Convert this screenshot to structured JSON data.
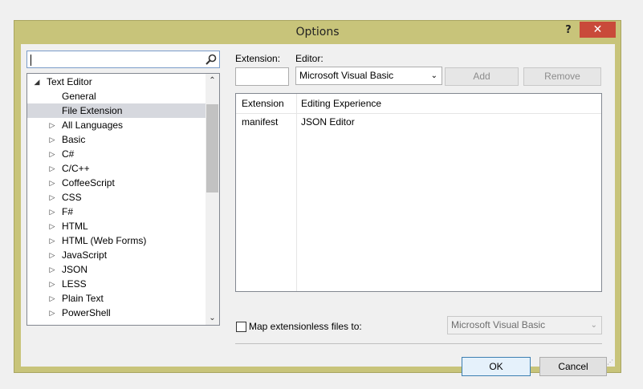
{
  "window": {
    "title": "Options",
    "help": "?",
    "close": "✕"
  },
  "search": {
    "value": ""
  },
  "tree": {
    "items": [
      {
        "label": "Text Editor",
        "toggle": "◢"
      },
      {
        "label": "General",
        "toggle": ""
      },
      {
        "label": "File Extension",
        "toggle": ""
      },
      {
        "label": "All Languages",
        "toggle": "▷"
      },
      {
        "label": "Basic",
        "toggle": "▷"
      },
      {
        "label": "C#",
        "toggle": "▷"
      },
      {
        "label": "C/C++",
        "toggle": "▷"
      },
      {
        "label": "CoffeeScript",
        "toggle": "▷"
      },
      {
        "label": "CSS",
        "toggle": "▷"
      },
      {
        "label": "F#",
        "toggle": "▷"
      },
      {
        "label": "HTML",
        "toggle": "▷"
      },
      {
        "label": "HTML (Web Forms)",
        "toggle": "▷"
      },
      {
        "label": "JavaScript",
        "toggle": "▷"
      },
      {
        "label": "JSON",
        "toggle": "▷"
      },
      {
        "label": "LESS",
        "toggle": "▷"
      },
      {
        "label": "Plain Text",
        "toggle": "▷"
      },
      {
        "label": "PowerShell",
        "toggle": "▷"
      }
    ],
    "selected": "File Extension"
  },
  "extension": {
    "label": "Extension:",
    "value": ""
  },
  "editor": {
    "label": "Editor:",
    "selected": "Microsoft Visual Basic"
  },
  "buttons": {
    "add": "Add",
    "remove": "Remove",
    "ok": "OK",
    "cancel": "Cancel"
  },
  "mappings": {
    "columns": [
      "Extension",
      "Editing Experience"
    ],
    "rows": [
      {
        "extension": "manifest",
        "editor": "JSON Editor"
      }
    ]
  },
  "map_extensionless": {
    "label": "Map extensionless files to:",
    "checked": false,
    "selected": "Microsoft Visual Basic"
  },
  "colors": {
    "frame": "#c8c47a",
    "close": "#c94a3a",
    "selection": "#d6d8de"
  }
}
